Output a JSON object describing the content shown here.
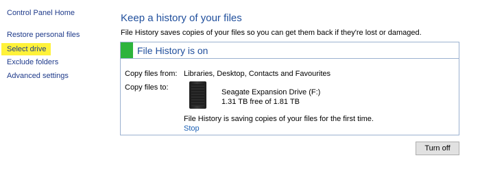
{
  "sidebar": {
    "home_label": "Control Panel Home",
    "items": [
      {
        "label": "Restore personal files"
      },
      {
        "label": "Select drive",
        "highlight_color": "#fff23a"
      },
      {
        "label": "Exclude folders"
      },
      {
        "label": "Advanced settings"
      }
    ]
  },
  "main": {
    "title": "Keep a history of your files",
    "description": "File History saves copies of your files so you can get them back if they're lost or damaged."
  },
  "status_panel": {
    "status_text": "File History is on",
    "status_color": "#2db43c",
    "copy_from_label": "Copy files from:",
    "copy_from_value": "Libraries, Desktop, Contacts and Favourites",
    "copy_to_label": "Copy files to:",
    "drive": {
      "icon": "external-drive-icon",
      "name": "Seagate Expansion Drive (F:)",
      "free_space": "1.31 TB free of 1.81 TB"
    },
    "saving_message": "File History is saving copies of your files for the first time.",
    "stop_label": "Stop"
  },
  "actions": {
    "turn_off_label": "Turn off"
  },
  "colors": {
    "link": "#1e3a8a",
    "title": "#1f4e9c",
    "panel_border": "#9ab0cf"
  }
}
